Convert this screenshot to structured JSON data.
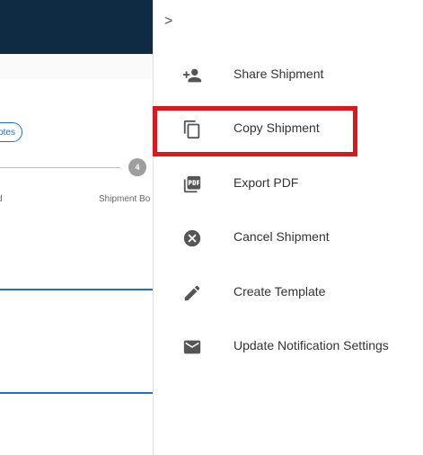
{
  "background": {
    "notes_label": "otes",
    "step_number": "4",
    "step_left_label": "d",
    "step_right_label": "Shipment Bo"
  },
  "drawer": {
    "collapse_glyph": ">",
    "items": [
      {
        "label": "Share Shipment",
        "icon": "person-add-icon"
      },
      {
        "label": "Copy Shipment",
        "icon": "copy-icon"
      },
      {
        "label": "Export PDF",
        "icon": "pdf-icon"
      },
      {
        "label": "Cancel Shipment",
        "icon": "cancel-icon"
      },
      {
        "label": "Create Template",
        "icon": "pencil-icon"
      },
      {
        "label": "Update Notification Settings",
        "icon": "envelope-icon"
      }
    ]
  },
  "colors": {
    "header_bg": "#0f2b44",
    "accent_blue": "#1e6fd0",
    "highlight_red": "#e0161d",
    "icon_gray": "#555555"
  }
}
